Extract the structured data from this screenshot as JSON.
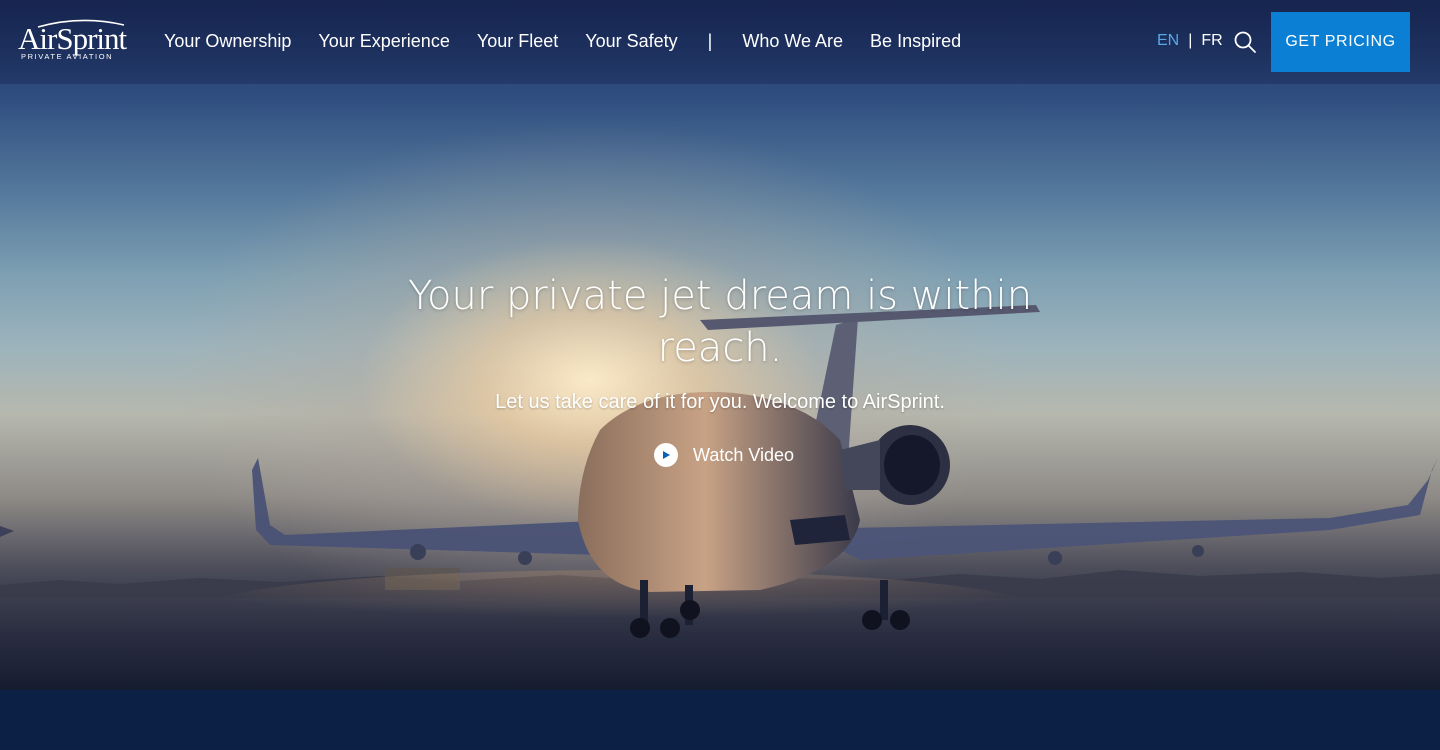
{
  "brand": {
    "name": "AirSprint",
    "tagline": "PRIVATE AVIATION"
  },
  "nav": {
    "items": [
      {
        "label": "Your Ownership"
      },
      {
        "label": "Your Experience"
      },
      {
        "label": "Your Fleet"
      },
      {
        "label": "Your Safety"
      },
      {
        "label": "Who We Are"
      },
      {
        "label": "Be Inspired"
      }
    ],
    "separator": "|"
  },
  "language": {
    "current": "EN",
    "separator": "|",
    "alternate": "FR"
  },
  "header": {
    "search_icon": "search-icon",
    "cta_label": "GET PRICING"
  },
  "hero": {
    "headline": "Your private jet dream is within reach.",
    "subhead": "Let us take care of it for you. Welcome to AirSprint.",
    "video_label": "Watch Video",
    "video_icon": "play-icon",
    "background": "private jet on tarmac at sunset"
  },
  "colors": {
    "accent": "#0a7fd3",
    "active_language": "#58a7e6",
    "navy": "#0c1f45"
  }
}
